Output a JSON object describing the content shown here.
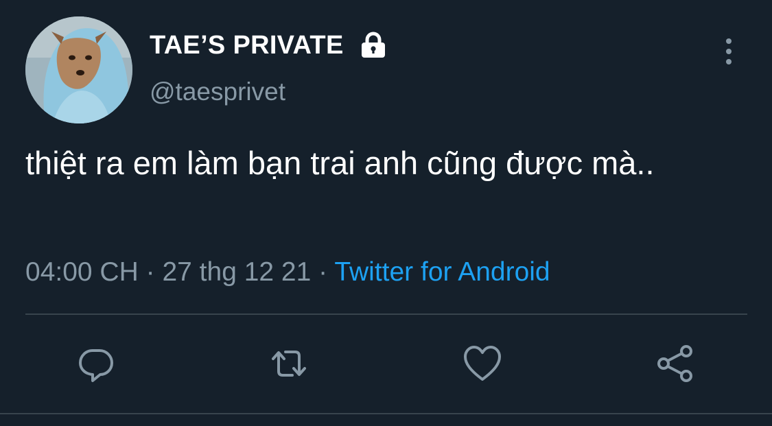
{
  "tweet": {
    "display_name": "TAE’S PRIVATE",
    "handle": "@taesprivet",
    "text": "thiệt ra em làm bạn trai anh cũng được mà..",
    "time": "04:00 CH",
    "date": "27 thg 12 21",
    "separator": "·",
    "source": "Twitter for Android"
  },
  "icons": {
    "lock": "lock-icon",
    "more": "more-vertical-icon",
    "reply": "reply-icon",
    "retweet": "retweet-icon",
    "like": "heart-icon",
    "share": "share-icon"
  },
  "colors": {
    "background": "#15202b",
    "secondary_text": "#8899a6",
    "link": "#1da1f2",
    "divider": "#38444d",
    "icon": "#8899a6"
  }
}
